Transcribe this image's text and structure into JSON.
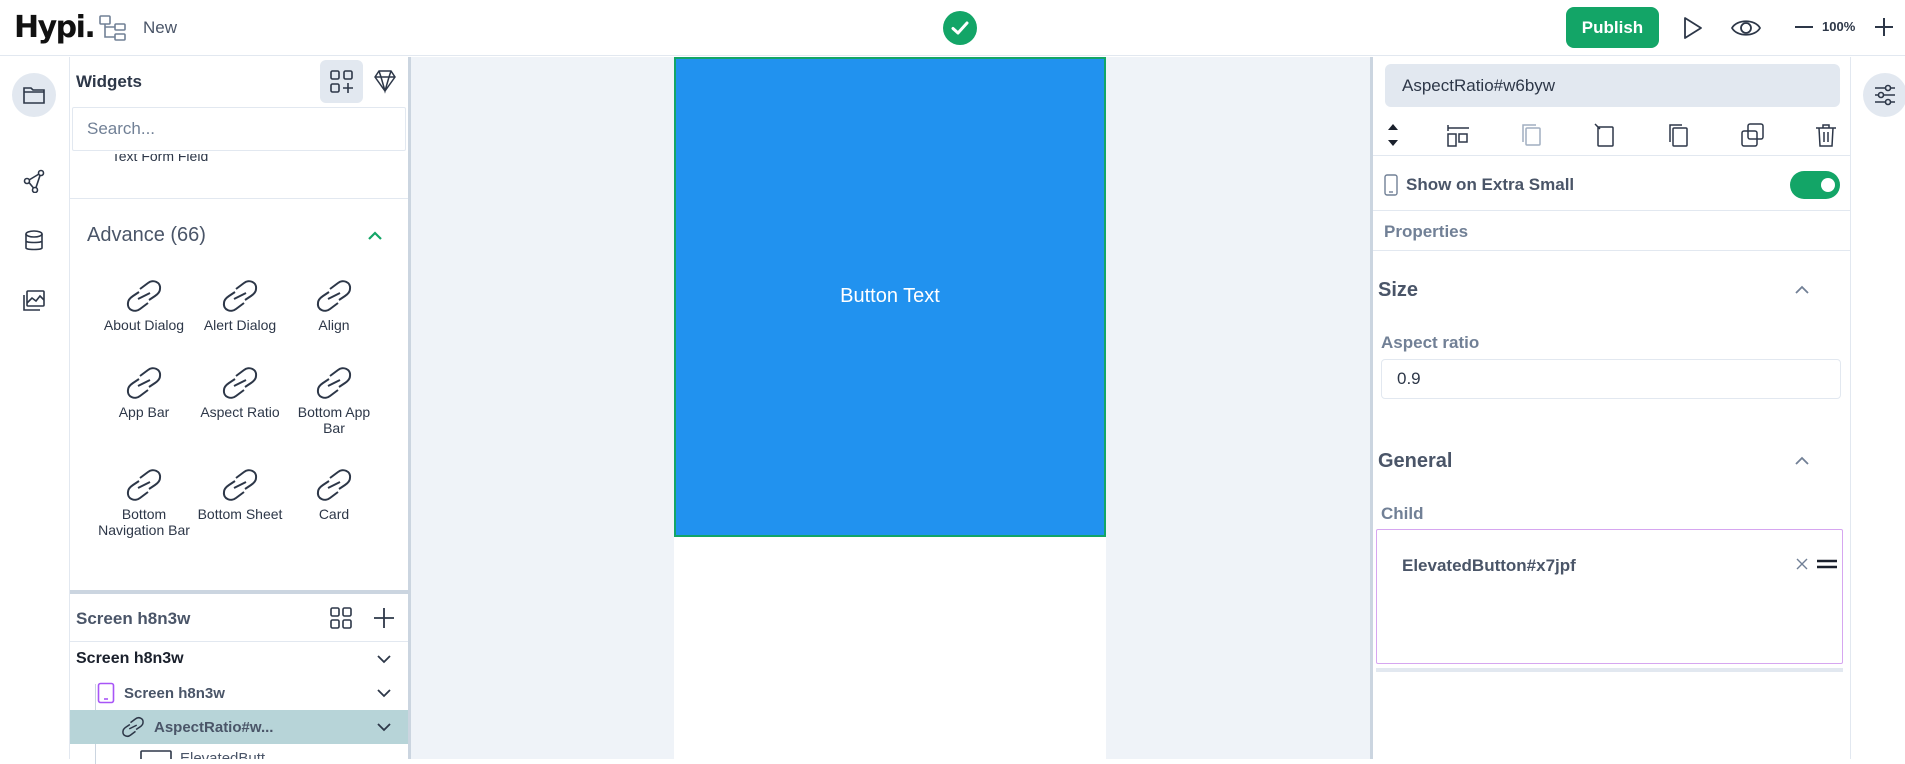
{
  "app": {
    "logo": "Hypi.",
    "new_label": "New",
    "publish_label": "Publish",
    "zoom": "100%"
  },
  "widgets": {
    "title": "Widgets",
    "search_placeholder": "Search...",
    "partial_item": "Text Form Field",
    "section_label": "Advance (66)",
    "items": [
      {
        "label": "About Dialog"
      },
      {
        "label": "Alert Dialog"
      },
      {
        "label": "Align"
      },
      {
        "label": "App Bar"
      },
      {
        "label": "Aspect Ratio"
      },
      {
        "label": "Bottom App Bar"
      },
      {
        "label": "Bottom Navigation Bar"
      },
      {
        "label": "Bottom Sheet"
      },
      {
        "label": "Card"
      }
    ]
  },
  "tree": {
    "header": "Screen h8n3w",
    "rows": [
      {
        "label": "Screen h8n3w"
      },
      {
        "label": "Screen h8n3w"
      },
      {
        "label": "AspectRatio#w..."
      },
      {
        "label": "ElevatedButt..."
      }
    ]
  },
  "canvas": {
    "button_text": "Button Text",
    "colors": {
      "widget_fill": "#2192ef",
      "selection": "#13a567"
    }
  },
  "properties": {
    "widget_name": "AspectRatio#w6byw",
    "show_on_label": "Show on Extra Small",
    "show_on_enabled": true,
    "properties_label": "Properties",
    "size_title": "Size",
    "aspect_ratio_label": "Aspect ratio",
    "aspect_ratio_value": "0.9",
    "general_title": "General",
    "child_label": "Child",
    "child_value": "ElevatedButton#x7jpf"
  },
  "colors": {
    "accent": "#13a567"
  }
}
